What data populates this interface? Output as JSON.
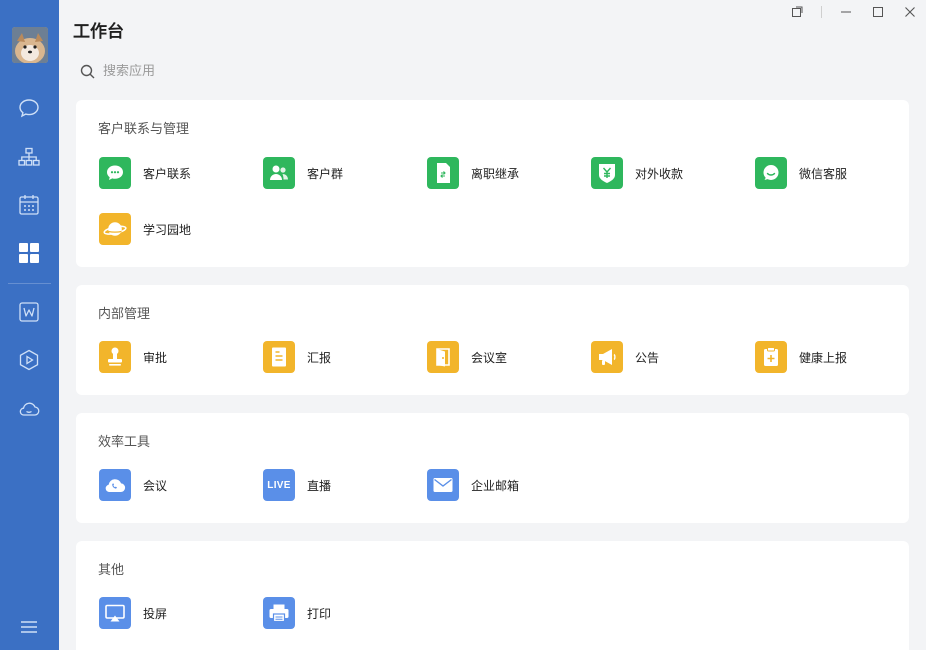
{
  "header": {
    "title": "工作台"
  },
  "search": {
    "placeholder": "搜索应用"
  },
  "sections": [
    {
      "title": "客户联系与管理",
      "apps": [
        {
          "label": "客户联系",
          "icon": "wechat-chat-icon",
          "color": "green"
        },
        {
          "label": "客户群",
          "icon": "customer-group-icon",
          "color": "green"
        },
        {
          "label": "离职继承",
          "icon": "resign-inherit-icon",
          "color": "green"
        },
        {
          "label": "对外收款",
          "icon": "yuan-shield-icon",
          "color": "green"
        },
        {
          "label": "微信客服",
          "icon": "wechat-service-icon",
          "color": "green"
        },
        {
          "label": "学习园地",
          "icon": "planet-icon",
          "color": "yellow"
        }
      ]
    },
    {
      "title": "内部管理",
      "apps": [
        {
          "label": "审批",
          "icon": "stamp-icon",
          "color": "yellow"
        },
        {
          "label": "汇报",
          "icon": "report-document-icon",
          "color": "yellow"
        },
        {
          "label": "会议室",
          "icon": "door-icon",
          "color": "yellow"
        },
        {
          "label": "公告",
          "icon": "megaphone-icon",
          "color": "yellow"
        },
        {
          "label": "健康上报",
          "icon": "health-clipboard-icon",
          "color": "yellow"
        }
      ]
    },
    {
      "title": "效率工具",
      "apps": [
        {
          "label": "会议",
          "icon": "cloud-phone-icon",
          "color": "blue"
        },
        {
          "label": "直播",
          "icon": "live-icon",
          "color": "blue",
          "badge": "LIVE"
        },
        {
          "label": "企业邮箱",
          "icon": "mail-icon",
          "color": "blue"
        }
      ]
    },
    {
      "title": "其他",
      "apps": [
        {
          "label": "投屏",
          "icon": "screen-cast-icon",
          "color": "blue"
        },
        {
          "label": "打印",
          "icon": "printer-icon",
          "color": "blue"
        }
      ]
    }
  ],
  "colors": {
    "sidebar": "#3b70c4",
    "green": "#2fb75d",
    "yellow": "#f2b52b",
    "blue": "#5a8fe8"
  }
}
